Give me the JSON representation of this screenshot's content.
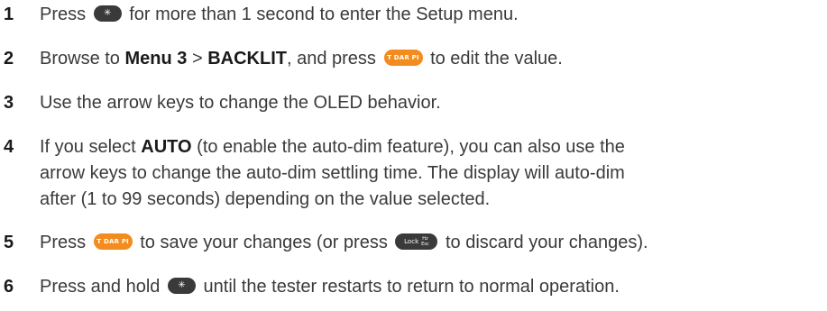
{
  "steps": [
    {
      "number": "1",
      "pre": "Press",
      "key": "",
      "post": "for more than 1 second to enter the Setup menu."
    },
    {
      "number": "2",
      "pre": "Browse to",
      "bold1": "Menu 3",
      "sep": ">",
      "bold2": "BACKLIT",
      "mid": ", and press",
      "key": "T DAR PI",
      "post": "to edit the value."
    },
    {
      "number": "3",
      "text": "Use the arrow keys to change the OLED behavior."
    },
    {
      "number": "4",
      "pre": "If you select",
      "bold": "AUTO",
      "post1": "(to enable the auto-dim feature), you can also use the",
      "line2": "arrow keys to change the auto-dim settling time. The display will auto-dim",
      "line3": "after (1 to 99 seconds) depending on the value selected."
    },
    {
      "number": "5",
      "pre": "Press",
      "key1": "T DAR PI",
      "mid": "to save your changes (or press",
      "key2": "Lock",
      "key2_sub_top": "Hz",
      "key2_sub_bottom": "Esc",
      "post": "to discard your changes)."
    },
    {
      "number": "6",
      "pre": "Press and hold",
      "key": "",
      "post": "until the tester restarts to return to normal operation."
    }
  ],
  "icons": {
    "backlight_key_symbol": "sun-star-icon"
  },
  "colors": {
    "text": "#3a3a3a",
    "number": "#1a1a1a",
    "key_dark": "#3a3a3a",
    "key_orange": "#f28c1e"
  }
}
